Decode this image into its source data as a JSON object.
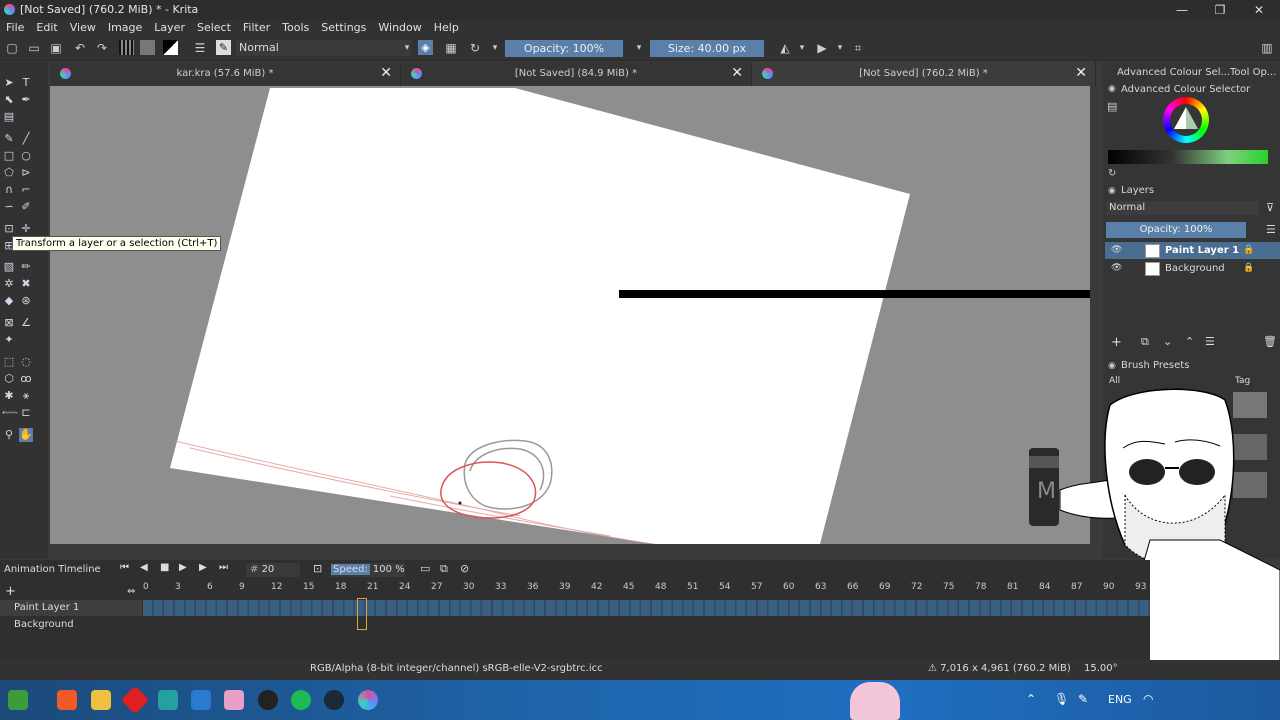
{
  "window": {
    "title": "[Not Saved]  (760.2 MiB) * - Krita",
    "min": "—",
    "max": "❐",
    "close": "✕"
  },
  "menu": [
    "File",
    "Edit",
    "View",
    "Image",
    "Layer",
    "Select",
    "Filter",
    "Tools",
    "Settings",
    "Window",
    "Help"
  ],
  "toolbar": {
    "blend_mode": "Normal",
    "opacity": "Opacity: 100%",
    "size": "Size: 40.00 px"
  },
  "tabs": [
    {
      "label": "kar.kra (57.6 MiB) *",
      "close": "✕"
    },
    {
      "label": "[Not Saved]  (84.9 MiB) *",
      "close": "✕"
    },
    {
      "label": "[Not Saved]  (760.2 MiB) *",
      "close": "✕"
    }
  ],
  "tooltip": "Transform a layer or a selection (Ctrl+T)",
  "dock": {
    "tabs": [
      "Advanced Colour Sel...",
      "Tool Op..."
    ],
    "colour_selector_title": "Advanced Colour Selector",
    "layers_title": "Layers",
    "layers_blend": "Normal",
    "layers_opacity": "Opacity: 100%",
    "layers": [
      {
        "name": "Paint Layer 1",
        "selected": true
      },
      {
        "name": "Background",
        "selected": false
      }
    ],
    "brush_presets_title": "Brush Presets",
    "brush_filter": "All",
    "brush_tag": "Tag"
  },
  "timeline": {
    "title": "Animation Timeline",
    "frame": "20",
    "speed_label": "Speed:",
    "speed_value": "100 %",
    "frames": [
      "0",
      "3",
      "6",
      "9",
      "12",
      "15",
      "18",
      "21",
      "24",
      "27",
      "30",
      "33",
      "36",
      "39",
      "42",
      "45",
      "48",
      "51",
      "54",
      "57",
      "60",
      "63",
      "66",
      "69",
      "72",
      "75",
      "78",
      "81",
      "84",
      "87",
      "90",
      "93"
    ],
    "layers": [
      "Paint Layer 1",
      "Background"
    ]
  },
  "status": {
    "color_profile": "RGB/Alpha (8-bit integer/channel)  sRGB-elle-V2-srgbtrc.icc",
    "dimensions": "7,016 x 4,961 (760.2 MiB)",
    "rotation": "15.00°"
  },
  "taskbar": {
    "language": "ENG"
  },
  "colors": {
    "accent": "#5a7fa8",
    "selected_layer": "#4a6d92"
  }
}
